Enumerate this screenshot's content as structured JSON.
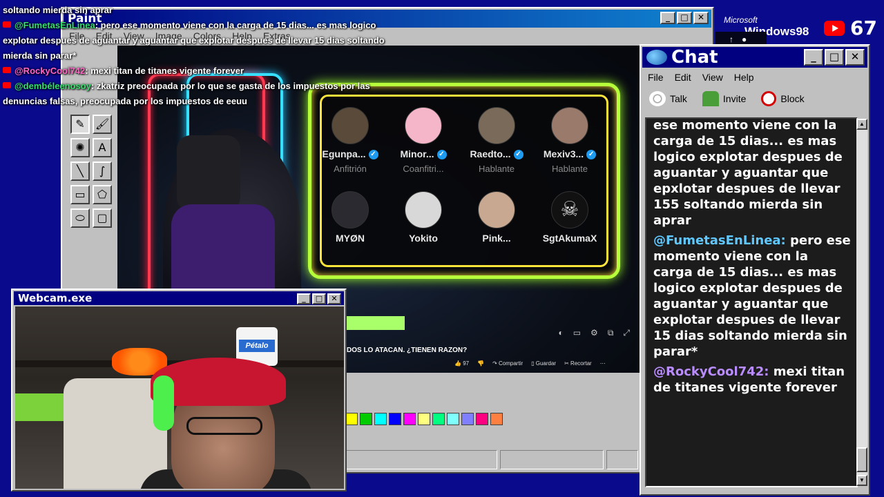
{
  "overlay_chat": {
    "lines": [
      {
        "user": "",
        "text": "soltando mierda sin aprar"
      },
      {
        "user": "@FumetasEnLinea",
        "text": ": pero ese momento viene con la carga de 15 dias... es mas logico explotar despues de aguantar y aguantar que explotar despues de llevar 15 dias soltando mierda sin parar*"
      },
      {
        "user": "@RockyCool742",
        "text": ": mexi titan de titanes vigente forever"
      },
      {
        "user": "@dembéleenosoy",
        "text": ": zkatriz preocupada por lo que se gasta de los impuestos por las denuncias falsas, preocupada por los impuestos de eeuu"
      }
    ]
  },
  "paint": {
    "title": "Paint",
    "menu": [
      "File",
      "Edit",
      "View",
      "Image",
      "Colors",
      "Help",
      "Extras"
    ],
    "palette": [
      "#ffff00",
      "#00cc00",
      "#00ffff",
      "#0000ff",
      "#ff00ff",
      "#ffff80",
      "#00ff80",
      "#80ffff",
      "#8080ff",
      "#ff0080",
      "#ff8040"
    ]
  },
  "video": {
    "participants": [
      {
        "name": "Egunpa...",
        "role": "Anfitrión",
        "verified": true,
        "avatar": "#5a4a3a"
      },
      {
        "name": "Minor...",
        "role": "Coanfitri...",
        "verified": true,
        "avatar": "#f4b6c8"
      },
      {
        "name": "Raedto...",
        "role": "Hablante",
        "verified": true,
        "avatar": "#7a6a5a"
      },
      {
        "name": "Mexiv3...",
        "role": "Hablante",
        "verified": true,
        "avatar": "#9a7a6a"
      },
      {
        "name": "MYØN",
        "role": "",
        "verified": false,
        "avatar": "#2a2a30"
      },
      {
        "name": "Yokito",
        "role": "",
        "verified": false,
        "avatar": "#d8d8d8"
      },
      {
        "name": "Pink...",
        "role": "",
        "verified": false,
        "avatar": "#c8a890"
      },
      {
        "name": "SgtAkumaX",
        "role": "",
        "verified": false,
        "avatar": "#111111"
      }
    ],
    "title": "DOS LO ATACAN. ¿TIENEN RAZON?",
    "likes": "97",
    "share": "Compartir",
    "save": "Guardar",
    "clip": "Recortar"
  },
  "webcam": {
    "title": "Webcam.exe",
    "paper_brand": "Pétalo"
  },
  "top_right": {
    "microsoft": "Microsoft",
    "windows": "Windows98",
    "score": "67"
  },
  "chat": {
    "title": "Chat",
    "menu": [
      "File",
      "Edit",
      "View",
      "Help"
    ],
    "toolbar": [
      "Talk",
      "Invite",
      "Block"
    ],
    "messages": [
      {
        "user": "",
        "text": "ese momento viene con la carga de 15 dias... es mas logico explotar despues de aguantar y aguantar que epxlotar despues de llevar 155 soltando mierda sin aprar"
      },
      {
        "user": "@FumetasEnLinea:",
        "text": " pero ese momento viene con la carga de 15 dias... es mas logico explotar despues de aguantar y aguantar que explotar despues de llevar 15 dias soltando mierda sin parar*"
      },
      {
        "user": "@RockyCool742:",
        "text": " mexi titan de titanes vigente forever"
      }
    ]
  }
}
